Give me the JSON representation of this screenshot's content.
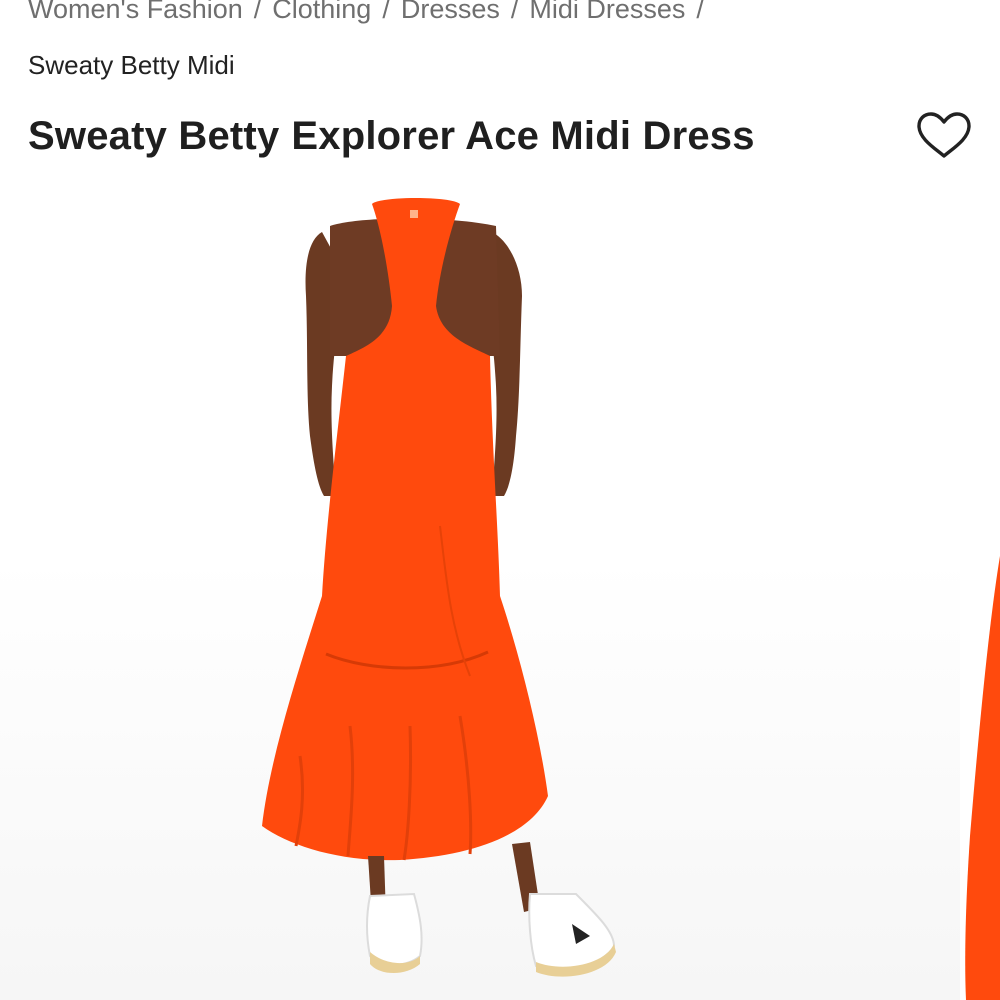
{
  "breadcrumb": {
    "items": [
      "Women's Fashion",
      "Clothing",
      "Dresses",
      "Midi Dresses"
    ],
    "separator": "/",
    "current": "Sweaty Betty Midi"
  },
  "product": {
    "brand": "Sweaty Betty",
    "name": "Explorer Ace Midi Dress",
    "dress_color": "#ff4a0d"
  },
  "icons": {
    "wishlist": "heart-outline-icon"
  }
}
